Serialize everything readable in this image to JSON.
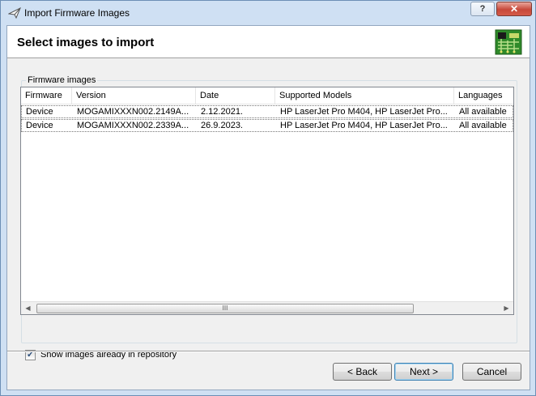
{
  "window": {
    "title": "Import Firmware Images"
  },
  "titlebar": {
    "help_label": "?",
    "close_label": "✕"
  },
  "header": {
    "title": "Select images to import",
    "icon": "circuit-board-icon"
  },
  "group": {
    "label": "Firmware images"
  },
  "table": {
    "columns": [
      "Firmware",
      "Version",
      "Date",
      "Supported Models",
      "Languages"
    ],
    "rows": [
      [
        "Device",
        "MOGAMIXXXN002.2149A...",
        "2.12.2021.",
        "HP LaserJet Pro M404, HP LaserJet Pro...",
        "All available"
      ],
      [
        "Device",
        "MOGAMIXXXN002.2339A...",
        "26.9.2023.",
        "HP LaserJet Pro M404, HP LaserJet Pro...",
        "All available"
      ]
    ]
  },
  "scrollbar": {
    "left_arrow": "◀",
    "right_arrow": "▶",
    "grip": "III"
  },
  "options": {
    "show_in_repo_label": "Show images already in repository",
    "show_in_repo_checked": true,
    "check_mark": "✓"
  },
  "buttons": {
    "back": "< Back",
    "next": "Next >",
    "cancel": "Cancel"
  }
}
